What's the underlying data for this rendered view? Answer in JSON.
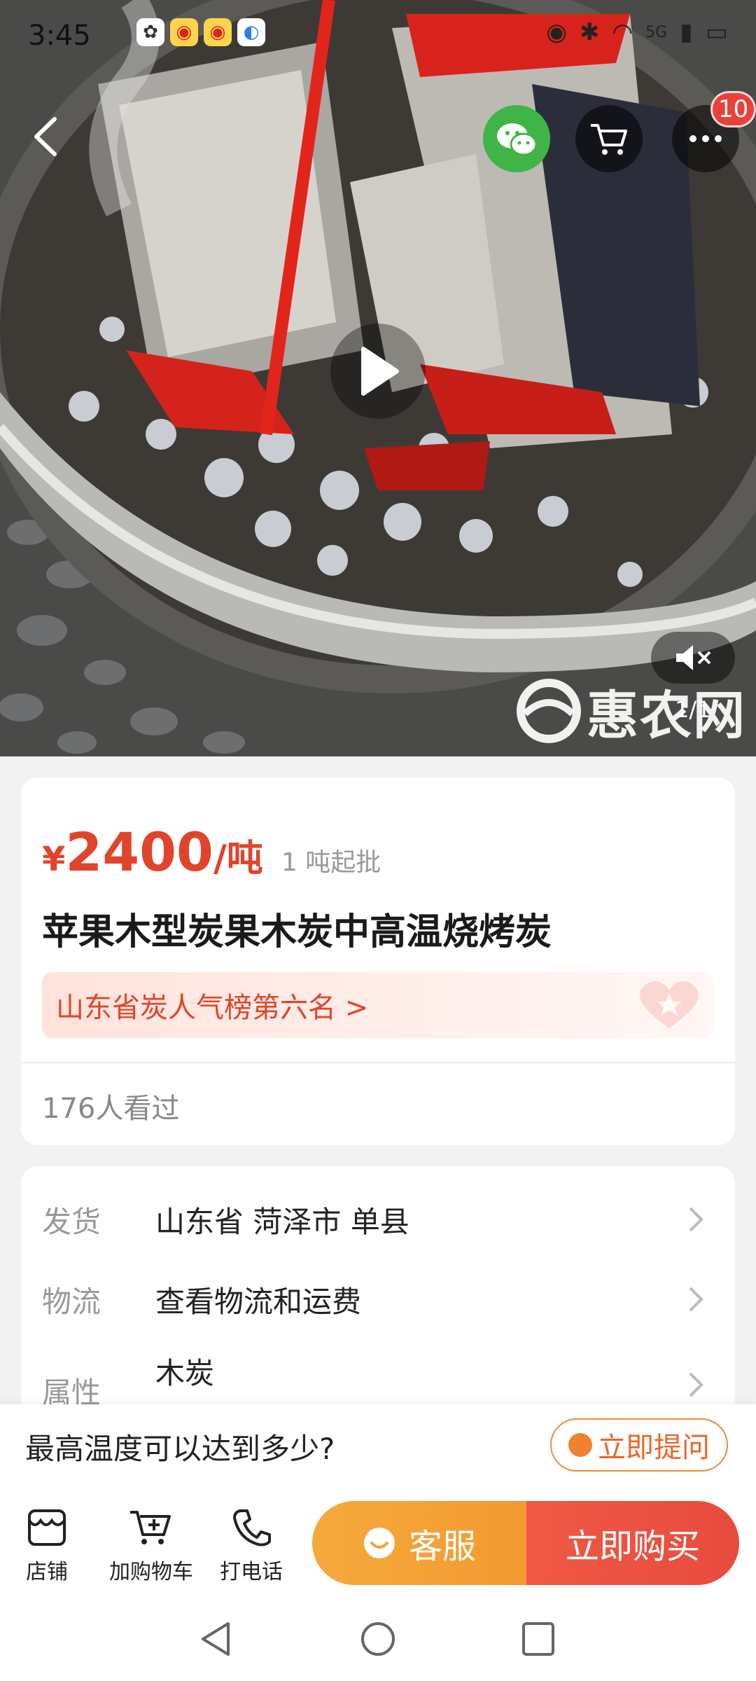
{
  "status_bar": {
    "time": "3:45",
    "network": "5G"
  },
  "header": {
    "cart_badge": "10"
  },
  "media": {
    "watermark": "惠农网",
    "counter": "1/1"
  },
  "product": {
    "currency": "¥",
    "price": "2400",
    "unit": "/吨",
    "min_order": "1 吨起批",
    "title": "苹果木型炭果木炭中高温烧烤炭",
    "rank": "山东省炭人气榜第六名 >",
    "views": "176人看过"
  },
  "info": {
    "rows": [
      {
        "label": "发货",
        "value": "山东省 菏泽市 单县"
      },
      {
        "label": "物流",
        "value": "查看物流和运费"
      },
      {
        "label": "属性",
        "value": "木炭"
      }
    ]
  },
  "question": {
    "text": "最高温度可以达到多少?",
    "ask_label": "立即提问"
  },
  "actions": {
    "shop": "店铺",
    "add_cart": "加购物车",
    "call": "打电话",
    "service": "客服",
    "buy": "立即购买"
  },
  "colors": {
    "accent": "#e0452b",
    "service": "#f4a23a",
    "buy": "#e84b3e",
    "wechat": "#3fb548"
  }
}
